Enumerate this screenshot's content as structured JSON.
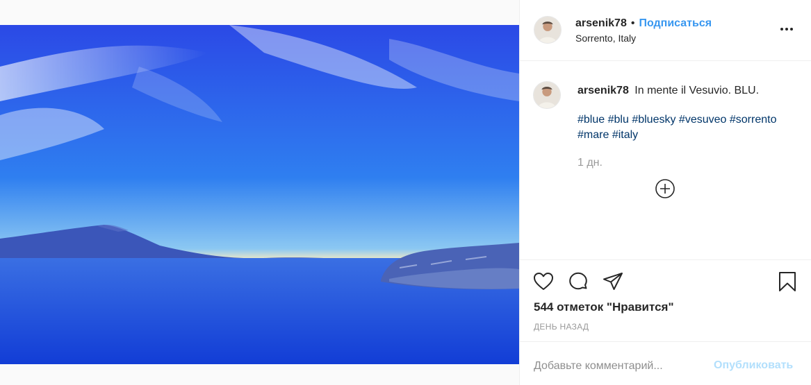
{
  "post": {
    "photo_alt": "In mente il Vesuvio. BLU.",
    "colors": {
      "accent": "#3897f0",
      "hashtag": "#003569",
      "muted": "#999999",
      "publish_disabled": "#b2dffc"
    }
  },
  "header": {
    "username": "arsenik78",
    "separator": "•",
    "follow_label": "Подписаться",
    "location": "Sorrento, Italy",
    "more_icon": "more-options-icon"
  },
  "caption": {
    "username": "arsenik78",
    "text": "In mente il Vesuvio. BLU.",
    "hashtags": [
      "#blue",
      "#blu",
      "#bluesky",
      "#vesuveo",
      "#sorrento",
      "#mare",
      "#italy"
    ],
    "time_ago": "1 дн.",
    "load_more_icon": "plus-circle-icon"
  },
  "actions": {
    "like_icon": "heart-icon",
    "comment_icon": "comment-icon",
    "share_icon": "send-icon",
    "save_icon": "bookmark-icon",
    "likes_text": "544 отметок \"Нравится\"",
    "posted_ago": "ДЕНЬ НАЗАД"
  },
  "comment": {
    "placeholder": "Добавьте комментарий...",
    "publish_label": "Опубликовать"
  }
}
